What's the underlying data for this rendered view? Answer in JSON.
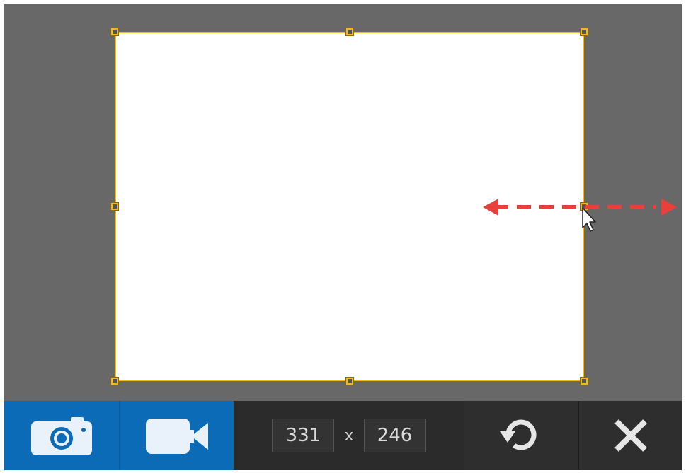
{
  "selection": {
    "width_value": "331",
    "height_value": "246",
    "separator": "x"
  },
  "toolbar": {
    "capture_image_icon": "camera-icon",
    "capture_video_icon": "video-camera-icon",
    "reset_icon": "rotate-ccw-icon",
    "close_icon": "close-icon"
  },
  "colors": {
    "overlay": "#686868",
    "selection_border": "#f0b81c",
    "toolbar_bg": "#2b2b2b",
    "accent_blue": "#0c6bb7",
    "resize_arrow": "#e8403a"
  }
}
